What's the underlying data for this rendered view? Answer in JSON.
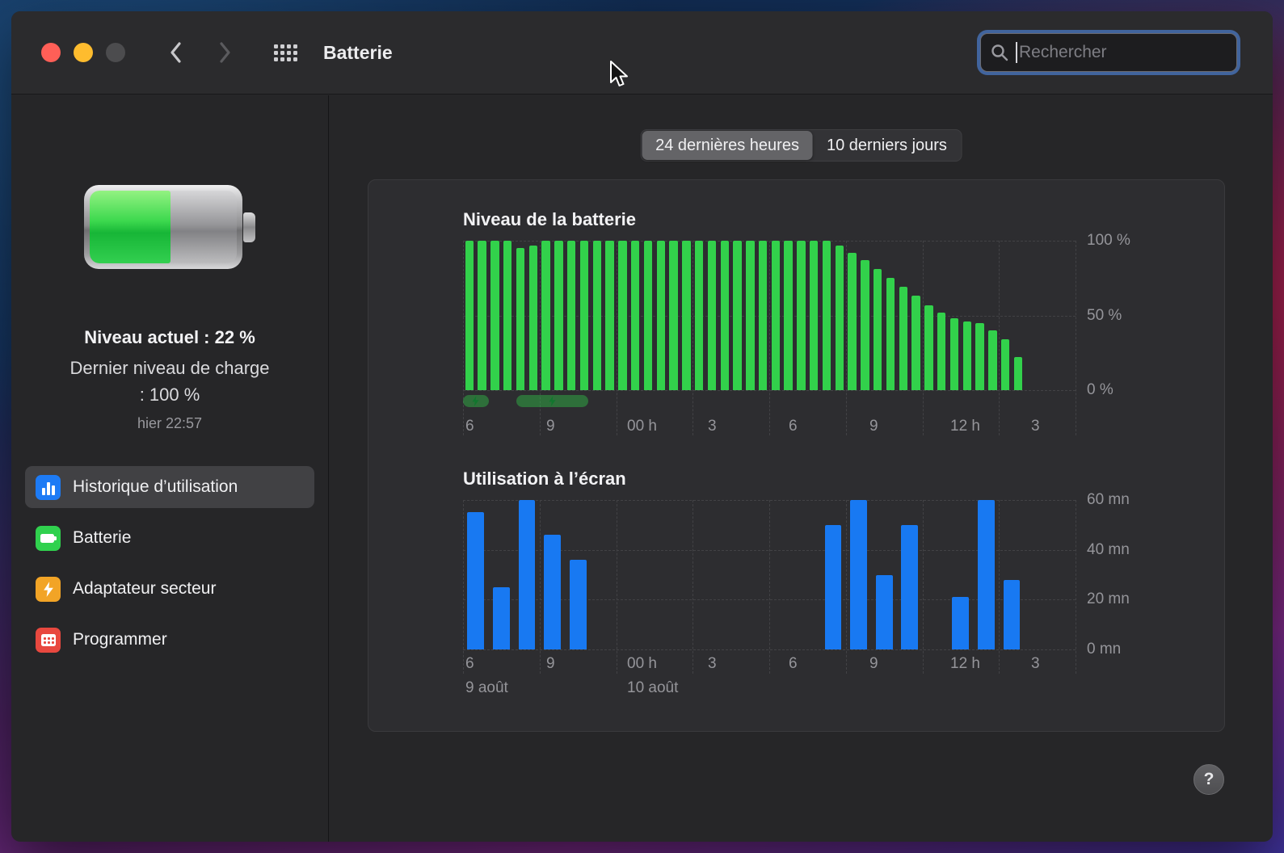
{
  "window": {
    "title": "Batterie",
    "search": {
      "placeholder": "Rechercher"
    }
  },
  "sidebar": {
    "battery_status": {
      "current_level_label": "Niveau actuel : 22 %",
      "last_charge_label": "Dernier niveau de charge : 100 %",
      "last_charge_time": "hier 22:57",
      "battery_fill_percent": 55
    },
    "items": [
      {
        "label": "Historique d’utilisation",
        "icon": "usage-history-icon",
        "selected": true
      },
      {
        "label": "Batterie",
        "icon": "battery-icon",
        "selected": false
      },
      {
        "label": "Adaptateur secteur",
        "icon": "power-adapter-icon",
        "selected": false
      },
      {
        "label": "Programmer",
        "icon": "schedule-icon",
        "selected": false
      }
    ]
  },
  "main": {
    "time_range_tabs": [
      {
        "label": "24 dernières heures",
        "selected": true
      },
      {
        "label": "10 derniers jours",
        "selected": false
      }
    ],
    "help_button_label": "?"
  },
  "chart_data": [
    {
      "type": "bar",
      "title": "Niveau de la batterie",
      "ylabel_ticks": [
        "100 %",
        "50 %",
        "0 %"
      ],
      "ylim": [
        0,
        100
      ],
      "x_ticks": [
        "6",
        "9",
        "00 h",
        "3",
        "6",
        "9",
        "12 h",
        "3"
      ],
      "x_axis_hours_total": 24,
      "bar_interval_minutes": 30,
      "bar_color": "#32d14b",
      "values": [
        100,
        100,
        100,
        100,
        95,
        97,
        100,
        100,
        100,
        100,
        100,
        100,
        100,
        100,
        100,
        100,
        100,
        100,
        100,
        100,
        100,
        100,
        100,
        100,
        100,
        100,
        100,
        100,
        100,
        97,
        92,
        87,
        81,
        75,
        69,
        63,
        57,
        52,
        48,
        46,
        45,
        40,
        34,
        22
      ],
      "charging_segments": [
        {
          "start_hour": 0,
          "end_hour": 1.0
        },
        {
          "start_hour": 2.1,
          "end_hour": 4.9
        }
      ]
    },
    {
      "type": "bar",
      "title": "Utilisation à l’écran",
      "ylabel_ticks": [
        "60 mn",
        "40 mn",
        "20 mn",
        "0 mn"
      ],
      "ylim": [
        0,
        60
      ],
      "x_ticks": [
        "6",
        "9",
        "00 h",
        "3",
        "6",
        "9",
        "12 h",
        "3"
      ],
      "x_axis_hours_total": 24,
      "bar_interval_minutes": 60,
      "bar_color": "#1879f2",
      "values": [
        55,
        25,
        60,
        46,
        36,
        0,
        0,
        0,
        0,
        0,
        0,
        0,
        0,
        0,
        50,
        60,
        30,
        50,
        0,
        21,
        60,
        28
      ],
      "date_labels": [
        {
          "text": "9 août",
          "tick_index": 0
        },
        {
          "text": "10 août",
          "tick_index": 2
        }
      ]
    }
  ]
}
